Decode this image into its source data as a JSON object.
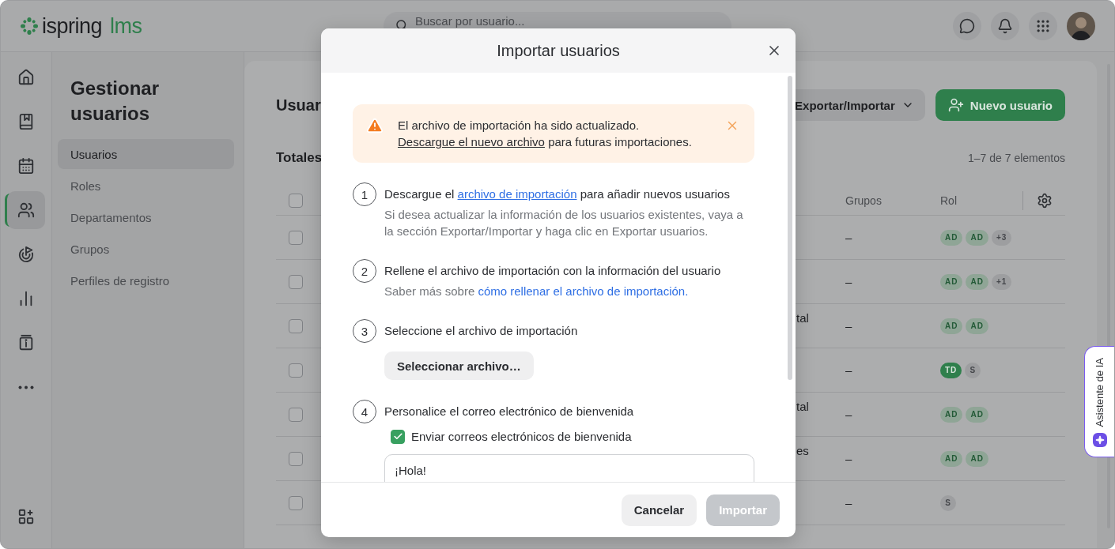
{
  "topbar": {
    "logo": {
      "word": "ispring",
      "suffix": "lms"
    },
    "search": {
      "placeholder": "Buscar por usuario..."
    }
  },
  "rail": {
    "items": [
      {
        "kind": "home",
        "selected": false
      },
      {
        "kind": "book",
        "selected": false
      },
      {
        "kind": "calendar",
        "selected": false
      },
      {
        "kind": "users",
        "selected": true
      },
      {
        "kind": "goal",
        "selected": false
      },
      {
        "kind": "chart",
        "selected": false
      },
      {
        "kind": "info",
        "selected": false
      },
      {
        "kind": "more",
        "selected": false
      }
    ],
    "bottom_items": [
      {
        "kind": "apps",
        "selected": false
      }
    ]
  },
  "nav": {
    "title": "Gestionar usuarios",
    "items": [
      {
        "label": "Usuarios",
        "selected": true
      },
      {
        "label": "Roles",
        "selected": false
      },
      {
        "label": "Departamentos",
        "selected": false
      },
      {
        "label": "Grupos",
        "selected": false
      },
      {
        "label": "Perfiles de registro",
        "selected": false
      }
    ]
  },
  "main": {
    "title": "Usuar",
    "export_button": "Exportar/Importar",
    "new_button": "Nuevo usuario",
    "totals": "Totales",
    "count": "1–7 de 7 elementos",
    "table": {
      "all_checked": false,
      "columns": {
        "groups": "Grupos",
        "role": "Rol"
      },
      "rows": [
        {
          "checked": false,
          "groups": "–",
          "roles": [
            {
              "label": "AD",
              "kind": "role"
            },
            {
              "label": "AD",
              "kind": "role"
            },
            {
              "label": "+3",
              "kind": "more"
            }
          ]
        },
        {
          "checked": false,
          "groups": "–",
          "roles": [
            {
              "label": "AD",
              "kind": "role"
            },
            {
              "label": "AD",
              "kind": "role"
            },
            {
              "label": "+1",
              "kind": "more"
            }
          ]
        },
        {
          "checked": false,
          "column_3": "tal",
          "groups": "–",
          "roles": [
            {
              "label": "AD",
              "kind": "role"
            },
            {
              "label": "AD",
              "kind": "role"
            }
          ]
        },
        {
          "checked": false,
          "groups": "–",
          "roles": [
            {
              "label": "TD",
              "kind": "active"
            },
            {
              "label": "S",
              "kind": "plain"
            }
          ]
        },
        {
          "checked": false,
          "column_3": "tal",
          "groups": "–",
          "roles": [
            {
              "label": "AD",
              "kind": "role"
            },
            {
              "label": "AD",
              "kind": "role"
            }
          ]
        },
        {
          "checked": false,
          "column_3": "es",
          "groups": "–",
          "roles": [
            {
              "label": "AD",
              "kind": "role"
            },
            {
              "label": "AD",
              "kind": "role"
            }
          ]
        },
        {
          "checked": false,
          "groups": "–",
          "roles": [
            {
              "label": "S",
              "kind": "plain"
            }
          ]
        }
      ]
    }
  },
  "assistant": {
    "label": "Asistente de IA"
  },
  "dialog": {
    "title": "Importar usuarios",
    "alert": {
      "text": "El archivo de importación ha sido actualizado.",
      "link": "Descargue el nuevo archivo",
      "after": "para futuras importaciones."
    },
    "steps": [
      {
        "number": "1",
        "title": "Descargue el",
        "title_link": "archivo de importación",
        "title_after": "para añadir nuevos usuarios",
        "note": "Si desea actualizar la información de los usuarios existentes, vaya a la sección Exportar/Importar y haga clic en Exportar usuarios."
      },
      {
        "number": "2",
        "title": "Rellene el archivo de importación con la información del usuario",
        "note": "Saber más sobre",
        "note_link": "cómo rellenar el archivo de importación."
      },
      {
        "number": "3",
        "title": "Seleccione el archivo de importación",
        "button": "Seleccionar archivo…"
      },
      {
        "number": "4",
        "title": "Personalice el correo electrónico de bienvenida",
        "checkbox": {
          "label": "Enviar correos electrónicos de bienvenida",
          "checked": true
        },
        "message": {
          "value": "¡Hola!"
        }
      }
    ],
    "footer": {
      "cancel": "Cancelar",
      "import": {
        "label": "Importar",
        "disabled": true
      }
    }
  }
}
